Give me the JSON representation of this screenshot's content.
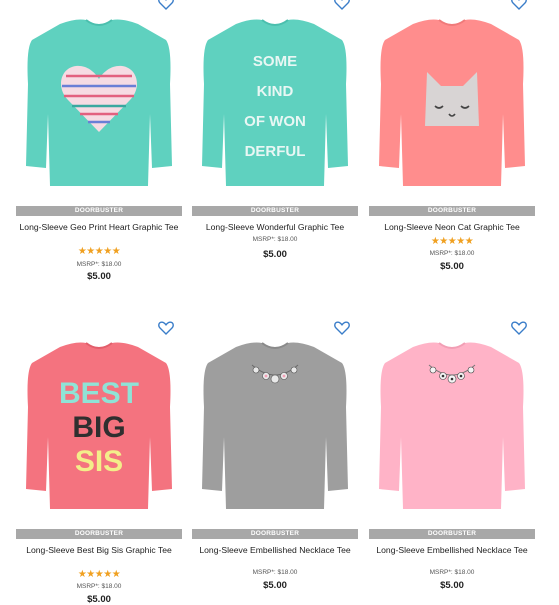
{
  "products": [
    {
      "name": "Long-Sleeve Geo Print Heart Graphic Tee",
      "badge": "DOORBUSTER",
      "stars": "★★★★★",
      "msrp": "MSRP*: $18.00",
      "price": "$5.00",
      "color": "#5fd1bf",
      "graphic": "heart"
    },
    {
      "name": "Long-Sleeve Wonderful Graphic Tee",
      "badge": "DOORBUSTER",
      "stars": "",
      "msrp": "MSRP*: $18.00",
      "price": "$5.00",
      "color": "#5fd1bf",
      "graphic": "text",
      "shirt_text": [
        "SOME",
        "KIND",
        "OF WON",
        "DERFUL"
      ]
    },
    {
      "name": "Long-Sleeve Neon Cat Graphic Tee",
      "badge": "DOORBUSTER",
      "stars": "★★★★★",
      "msrp": "MSRP*: $18.00",
      "price": "$5.00",
      "color": "#ff8d8d",
      "graphic": "cat"
    },
    {
      "name": "Long-Sleeve Best Big Sis Graphic Tee",
      "badge": "DOORBUSTER",
      "stars": "★★★★★",
      "msrp": "MSRP*: $18.00",
      "price": "$5.00",
      "color": "#f4737f",
      "graphic": "bigsis",
      "shirt_text": [
        "BEST",
        "BIG",
        "SIS"
      ]
    },
    {
      "name": "Long-Sleeve Embellished Necklace Tee",
      "badge": "DOORBUSTER",
      "stars": "",
      "msrp": "MSRP*: $18.00",
      "price": "$5.00",
      "color": "#9e9e9e",
      "graphic": "necklace"
    },
    {
      "name": "Long-Sleeve Embellished Necklace Tee",
      "badge": "DOORBUSTER",
      "stars": "",
      "msrp": "MSRP*: $18.00",
      "price": "$5.00",
      "color": "#ffb3c7",
      "graphic": "necklace"
    }
  ],
  "icons": {
    "wishlist": "heart-outline-icon",
    "wishlist_color": "#3a7dc9"
  }
}
